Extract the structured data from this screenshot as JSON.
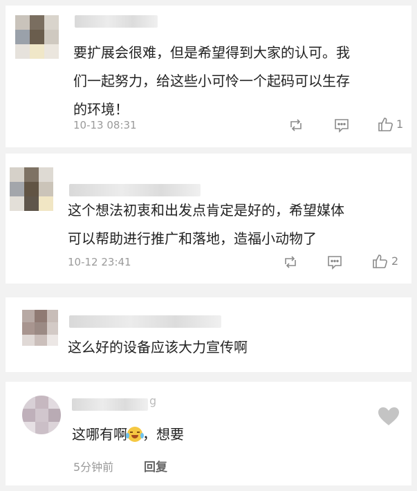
{
  "comments": [
    {
      "text_lines": [
        "要扩展会很难，但是希望得到大家的认可。我",
        "们一起努力，给这些小可怜一个起码可以生存",
        "的环境！"
      ],
      "time": "10-13 08:31",
      "likes": "1"
    },
    {
      "text_lines": [
        "这个想法初衷和出发点肯定是好的，希望媒体",
        "可以帮助进行推广和落地，造福小动物了"
      ],
      "time": "10-12 23:41",
      "likes": "2"
    },
    {
      "text_lines": [
        "这么好的设备应该大力宣传啊"
      ]
    },
    {
      "username_partial": "g",
      "text_before_emoji": "这哪有啊",
      "text_after_emoji": "，想要",
      "time": "5分钟前",
      "reply_label": "回复"
    }
  ],
  "colors": {
    "background": "#f2f2f2",
    "card": "#ffffff",
    "text": "#222222",
    "meta": "#9a9a9a",
    "icon": "#8a8a8a"
  },
  "icons": [
    "share-icon",
    "comment-icon",
    "thumbs-up-icon",
    "heart-icon",
    "crying-laughing-emoji-icon"
  ]
}
